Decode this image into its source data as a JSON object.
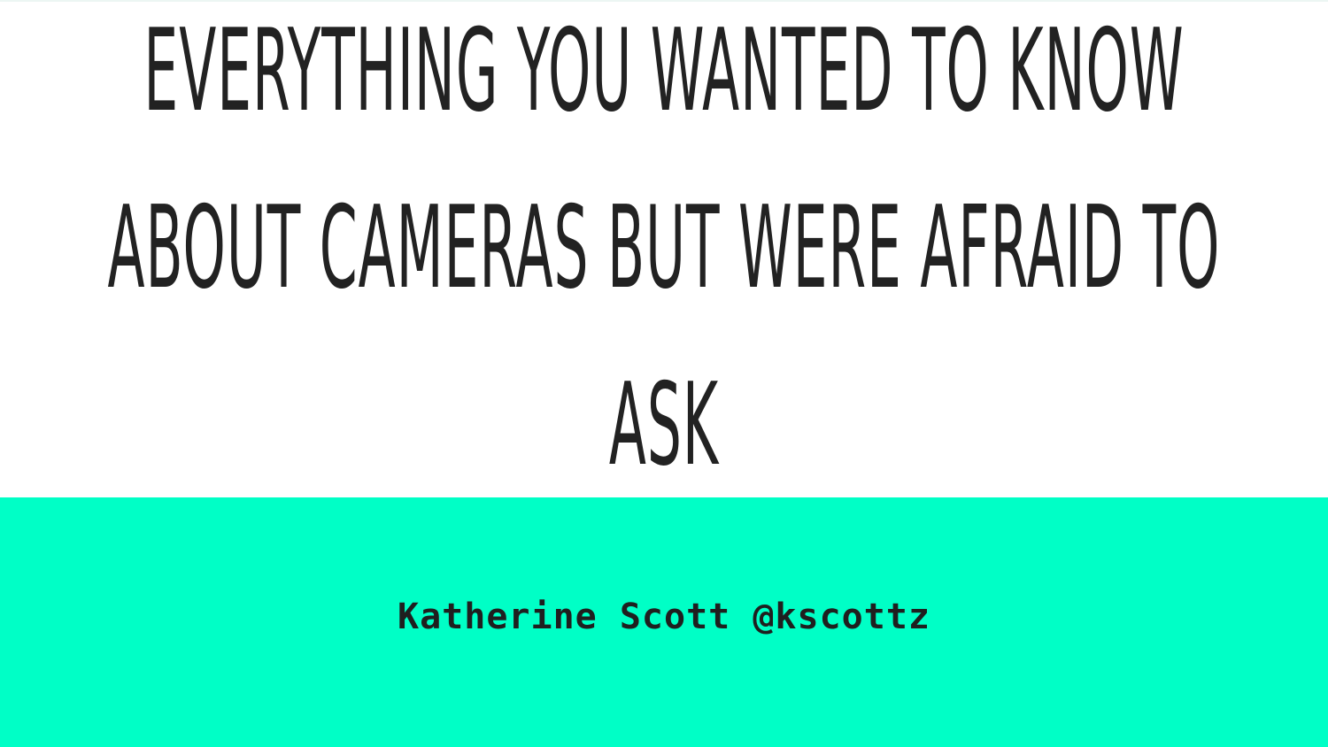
{
  "slide": {
    "title": "Everything you wanted to know about cameras but were afraid to ask",
    "subtitle": "Katherine Scott @kscottz"
  },
  "colors": {
    "background": "#ffffff",
    "accent_band": "#00ffc6",
    "text": "#222222"
  }
}
